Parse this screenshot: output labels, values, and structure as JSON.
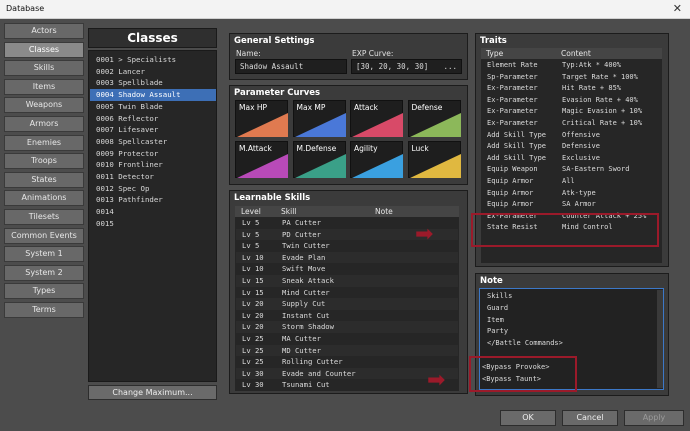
{
  "window": {
    "title": "Database",
    "close_glyph": "✕"
  },
  "categories": [
    "Actors",
    "Classes",
    "Skills",
    "Items",
    "Weapons",
    "Armors",
    "Enemies",
    "Troops",
    "States",
    "Animations",
    "Tilesets",
    "Common Events",
    "System 1",
    "System 2",
    "Types",
    "Terms"
  ],
  "active_category": "Classes",
  "classes": {
    "title": "Classes",
    "items": [
      "0001 > Specialists",
      "0002 Lancer",
      "0003 Spellblade",
      "0004 Shadow Assault",
      "0005 Twin Blade",
      "0006 Reflector",
      "0007 Lifesaver",
      "0008 Spellcaster",
      "0009 Protector",
      "0010 Frontliner",
      "0011 Detector",
      "0012 Spec Op",
      "0013 Pathfinder",
      "0014",
      "0015"
    ],
    "selected_index": 3,
    "change_max_label": "Change Maximum..."
  },
  "general": {
    "heading": "General Settings",
    "name_label": "Name:",
    "name_value": "Shadow Assault",
    "exp_label": "EXP Curve:",
    "exp_value": "[30, 20, 30, 30]",
    "exp_button": "..."
  },
  "curves": {
    "heading": "Parameter Curves",
    "items": [
      {
        "label": "Max HP",
        "color": "#e07a50"
      },
      {
        "label": "Max MP",
        "color": "#4a78d8"
      },
      {
        "label": "Attack",
        "color": "#d84a68"
      },
      {
        "label": "Defense",
        "color": "#8cb85a"
      },
      {
        "label": "M.Attack",
        "color": "#b84ab8"
      },
      {
        "label": "M.Defense",
        "color": "#3aa088"
      },
      {
        "label": "Agility",
        "color": "#3aa0e0"
      },
      {
        "label": "Luck",
        "color": "#e0b840"
      }
    ]
  },
  "skills": {
    "heading": "Learnable Skills",
    "columns": [
      "Level",
      "Skill",
      "Note"
    ],
    "rows": [
      [
        "Lv  5",
        "PA Cutter"
      ],
      [
        "Lv  5",
        "PD Cutter"
      ],
      [
        "Lv  5",
        "Twin Cutter"
      ],
      [
        "Lv 10",
        "Evade Plan"
      ],
      [
        "Lv 10",
        "Swift Move"
      ],
      [
        "Lv 15",
        "Sneak Attack"
      ],
      [
        "Lv 15",
        "Mind Cutter"
      ],
      [
        "Lv 20",
        "Supply Cut"
      ],
      [
        "Lv 20",
        "Instant Cut"
      ],
      [
        "Lv 20",
        "Storm Shadow"
      ],
      [
        "Lv 25",
        "MA Cutter"
      ],
      [
        "Lv 25",
        "MD Cutter"
      ],
      [
        "Lv 25",
        "Rolling Cutter"
      ],
      [
        "Lv 30",
        "Evade and Counter"
      ],
      [
        "Lv 30",
        "Tsunami Cut"
      ]
    ]
  },
  "traits": {
    "heading": "Traits",
    "columns": [
      "Type",
      "Content"
    ],
    "rows": [
      [
        "Element Rate",
        "Typ:Atk * 400%"
      ],
      [
        "Sp-Parameter",
        "Target Rate * 100%"
      ],
      [
        "Ex-Parameter",
        "Hit Rate + 85%"
      ],
      [
        "Ex-Parameter",
        "Evasion Rate + 40%"
      ],
      [
        "Ex-Parameter",
        "Magic Evasion + 10%"
      ],
      [
        "Ex-Parameter",
        "Critical Rate + 10%"
      ],
      [
        "Add Skill Type",
        "Offensive"
      ],
      [
        "Add Skill Type",
        "Defensive"
      ],
      [
        "Add Skill Type",
        "Exclusive"
      ],
      [
        "Equip Weapon",
        "SA-Eastern Sword"
      ],
      [
        "Equip Armor",
        "All"
      ],
      [
        "Equip Armor",
        "Atk-type"
      ],
      [
        "Equip Armor",
        "SA Armor"
      ],
      [
        "Ex-Parameter",
        "Counter Attack + 25%"
      ],
      [
        "State Resist",
        "Mind Control"
      ]
    ]
  },
  "note": {
    "heading": "Note",
    "lines": [
      "Skills",
      "Guard",
      "Item",
      "Party",
      "</Battle Commands>",
      "",
      "<Bypass Provoke>",
      "<Bypass Taunt>"
    ]
  },
  "footer": {
    "ok": "OK",
    "cancel": "Cancel",
    "apply": "Apply"
  },
  "highlight_color": "#9b1a2a"
}
